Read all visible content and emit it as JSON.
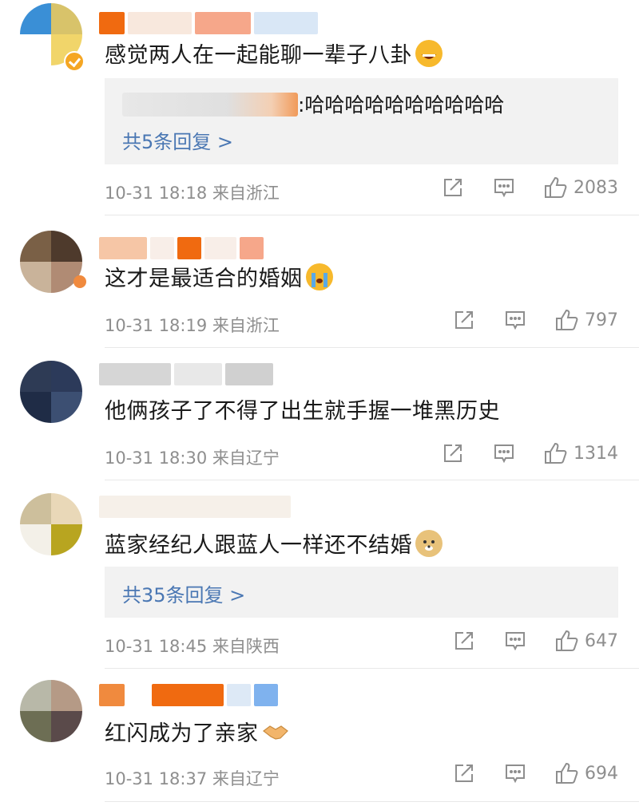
{
  "colors": {
    "link": "#4a77b3",
    "meta": "#8e8e8e",
    "reply_bg": "#f2f2f2"
  },
  "comments": [
    {
      "text": "感觉两人在一起能聊一辈子八卦",
      "emoji": "grin-emoji",
      "reply_preview": ":哈哈哈哈哈哈哈哈哈哈",
      "more_replies": "共5条回复 >",
      "time": "10-31 18:18",
      "location": "来自浙江",
      "likes": "2083"
    },
    {
      "text": "这才是最适合的婚姻",
      "emoji": "crying-emoji",
      "time": "10-31 18:19",
      "location": "来自浙江",
      "likes": "797"
    },
    {
      "text": "他俩孩子了不得了出生就手握一堆黑历史",
      "time": "10-31 18:30",
      "location": "来自辽宁",
      "likes": "1314"
    },
    {
      "text": "蓝家经纪人跟蓝人一样还不结婚",
      "emoji": "doge-emoji",
      "more_replies": "共35条回复 >",
      "time": "10-31 18:45",
      "location": "来自陕西",
      "likes": "647"
    },
    {
      "text": "红闪成为了亲家",
      "emoji": "handshake-emoji",
      "time": "10-31 18:37",
      "location": "来自辽宁",
      "likes": "694"
    }
  ]
}
